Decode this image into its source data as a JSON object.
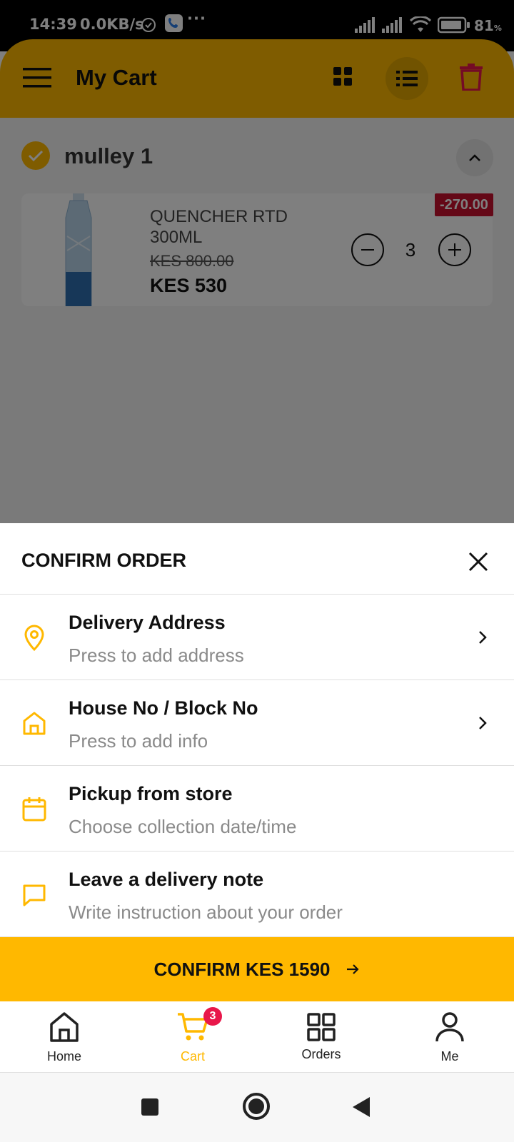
{
  "status_bar": {
    "time": "14:39",
    "network_speed": "0.0KB/s",
    "more": "···",
    "battery_percent": "81",
    "battery_unit": "%"
  },
  "header": {
    "title": "My Cart",
    "accent_color": "#FFB800"
  },
  "cart": {
    "store_name": "mulley 1",
    "items": [
      {
        "name": "QUENCHER RTD 300ML",
        "old_price": "KES 800.00",
        "price": "KES 530",
        "discount": "-270.00",
        "quantity": "3"
      }
    ]
  },
  "sheet": {
    "title": "CONFIRM ORDER",
    "options": [
      {
        "title": "Delivery Address",
        "subtitle": "Press to add address",
        "icon": "location-pin-icon"
      },
      {
        "title": "House No / Block No",
        "subtitle": "Press to add info",
        "icon": "house-icon"
      },
      {
        "title": "Pickup from store",
        "subtitle": "Choose collection date/time",
        "icon": "calendar-icon"
      },
      {
        "title": "Leave a delivery note",
        "subtitle": "Write instruction about your order",
        "icon": "chat-bubble-icon"
      }
    ],
    "confirm_label": "CONFIRM KES 1590"
  },
  "bottom_nav": {
    "items": [
      {
        "label": "Home",
        "icon": "home-icon"
      },
      {
        "label": "Cart",
        "icon": "cart-icon",
        "badge": "3"
      },
      {
        "label": "Orders",
        "icon": "grid-icon"
      },
      {
        "label": "Me",
        "icon": "person-icon"
      }
    ],
    "active": "Cart"
  }
}
